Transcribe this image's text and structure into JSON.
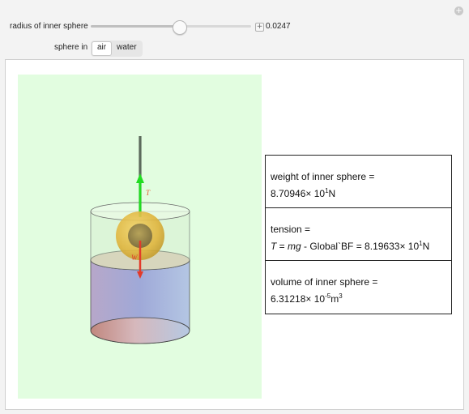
{
  "controls": {
    "radius_label": "radius of inner sphere",
    "radius_value": "0.0247",
    "radius_fraction": 0.55,
    "medium_label": "sphere in",
    "medium_options": [
      "air",
      "water"
    ],
    "medium_selected": "air"
  },
  "scene": {
    "tension_label": "T",
    "weight_label": "W"
  },
  "info": {
    "weight_title": "weight of inner sphere =",
    "weight_mantissa": "8.70946",
    "weight_times_ten": "× 10",
    "weight_exp": "1",
    "weight_unit": "N",
    "tension_title": "tension  =",
    "tension_T": "T",
    "tension_eq": " = ",
    "tension_mg": "mg",
    "tension_rest": " - Global`BF = 8.19633",
    "tension_times_ten": "× 10",
    "tension_exp": "1",
    "tension_unit": "N",
    "volume_title": "volume of inner sphere =",
    "volume_mantissa": "6.31218",
    "volume_times_ten": "× 10",
    "volume_exp": "-5",
    "volume_unit": "m",
    "volume_unit_exp": "3"
  },
  "colors": {
    "scene_bg": "#e2fde0",
    "tension_arrow": "#22dd22",
    "weight_arrow": "#e23a2a",
    "sphere": "#e8b820"
  }
}
